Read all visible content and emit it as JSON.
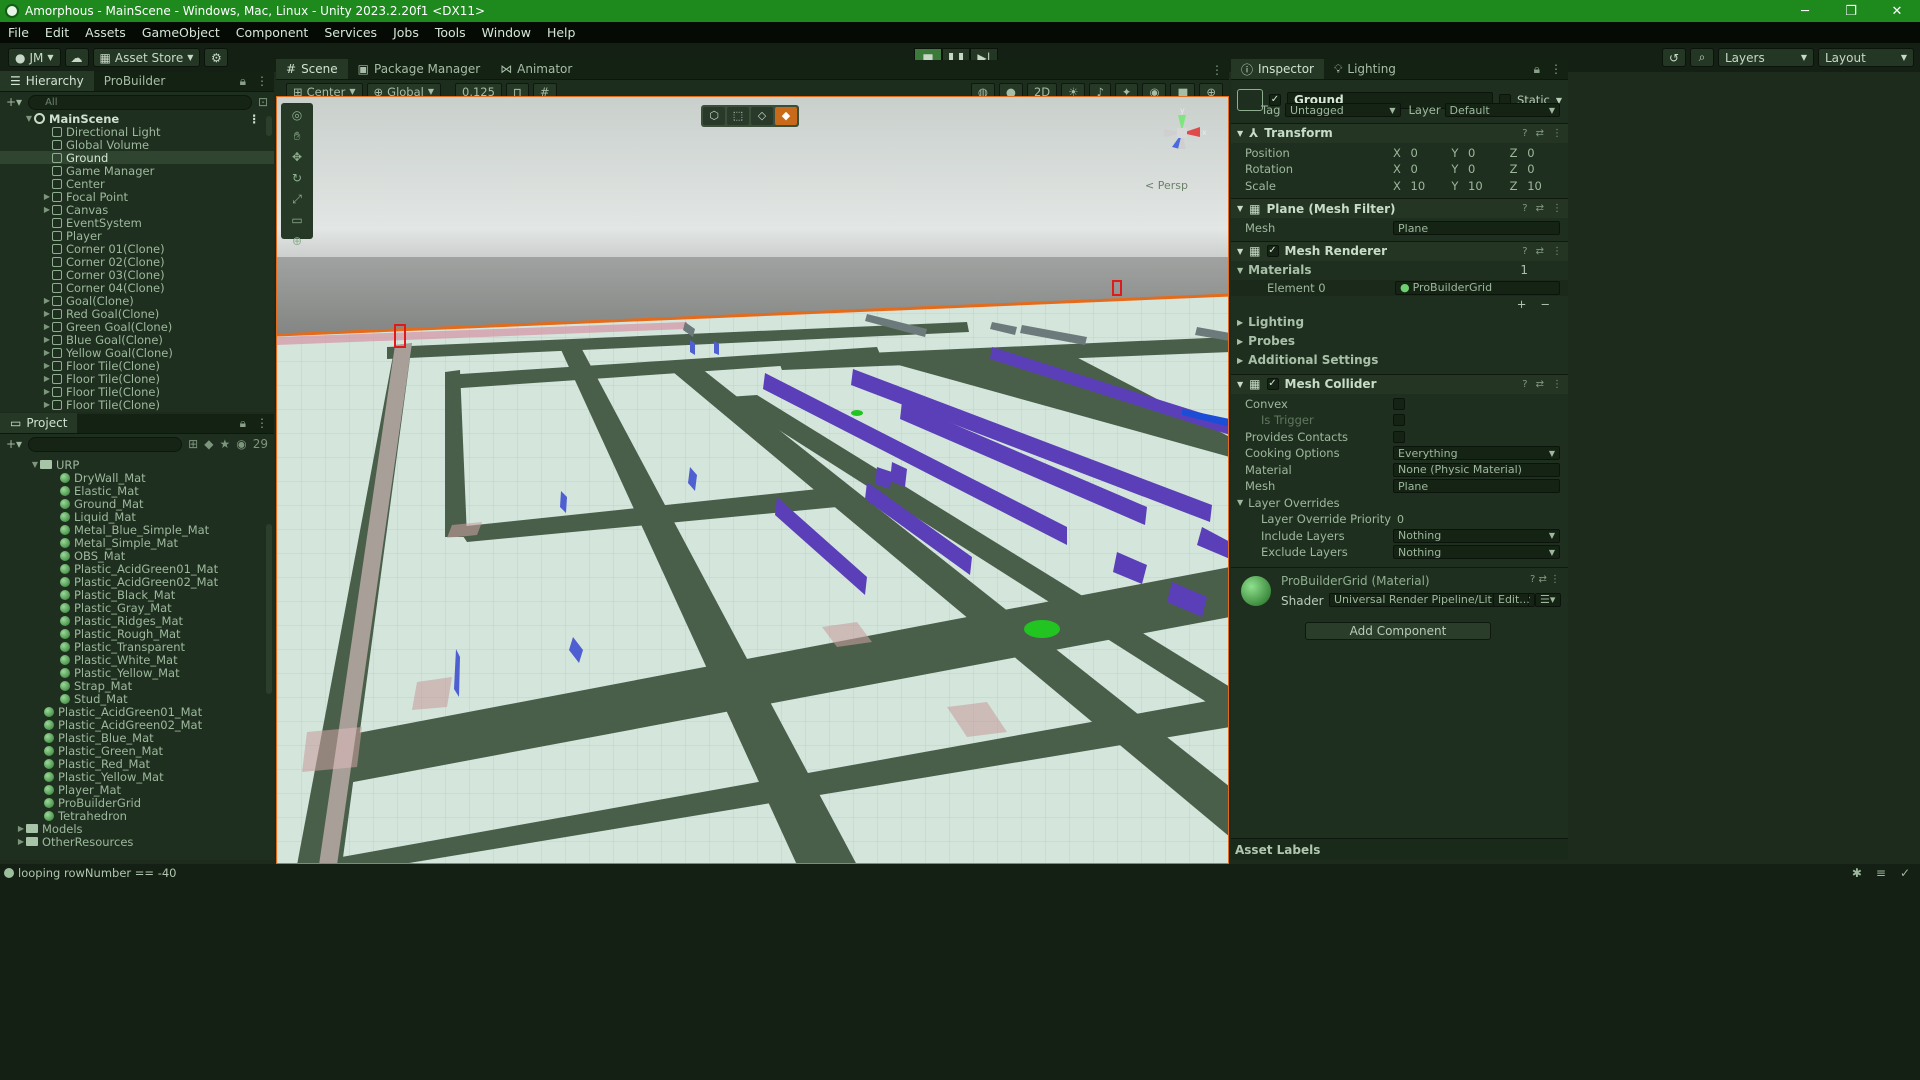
{
  "window": {
    "title": "Amorphous - MainScene - Windows, Mac, Linux - Unity 2023.2.20f1 <DX11>",
    "minimize": "─",
    "maximize": "❐",
    "close": "✕"
  },
  "menu": [
    "File",
    "Edit",
    "Assets",
    "GameObject",
    "Component",
    "Services",
    "Jobs",
    "Tools",
    "Window",
    "Help"
  ],
  "toolbar": {
    "account": "JM",
    "asset_store": "Asset Store",
    "layers": "Layers",
    "layout": "Layout"
  },
  "hierarchy": {
    "tabs": [
      "Hierarchy",
      "ProBuilder"
    ],
    "search_placeholder": "All",
    "scene": "MainScene",
    "items": [
      {
        "label": "Directional Light",
        "expandable": false
      },
      {
        "label": "Global Volume",
        "expandable": false
      },
      {
        "label": "Ground",
        "expandable": false,
        "selected": true
      },
      {
        "label": "Game Manager",
        "expandable": false
      },
      {
        "label": "Center",
        "expandable": false
      },
      {
        "label": "Focal Point",
        "expandable": true
      },
      {
        "label": "Canvas",
        "expandable": true
      },
      {
        "label": "EventSystem",
        "expandable": false
      },
      {
        "label": "Player",
        "expandable": false
      },
      {
        "label": "Corner 01(Clone)",
        "expandable": false
      },
      {
        "label": "Corner 02(Clone)",
        "expandable": false
      },
      {
        "label": "Corner 03(Clone)",
        "expandable": false
      },
      {
        "label": "Corner 04(Clone)",
        "expandable": false
      },
      {
        "label": "Goal(Clone)",
        "expandable": true
      },
      {
        "label": "Red Goal(Clone)",
        "expandable": true
      },
      {
        "label": "Green Goal(Clone)",
        "expandable": true
      },
      {
        "label": "Blue Goal(Clone)",
        "expandable": true
      },
      {
        "label": "Yellow Goal(Clone)",
        "expandable": true
      },
      {
        "label": "Floor Tile(Clone)",
        "expandable": true
      },
      {
        "label": "Floor Tile(Clone)",
        "expandable": true
      },
      {
        "label": "Floor Tile(Clone)",
        "expandable": true
      },
      {
        "label": "Floor Tile(Clone)",
        "expandable": true
      },
      {
        "label": "Floor Tile(Clone)",
        "expandable": true
      },
      {
        "label": "Floor Tile(Clone)",
        "expandable": true
      }
    ]
  },
  "project": {
    "tab": "Project",
    "count": "29",
    "urp_folder": "URP",
    "urp_items": [
      "DryWall_Mat",
      "Elastic_Mat",
      "Ground_Mat",
      "Liquid_Mat",
      "Metal_Blue_Simple_Mat",
      "Metal_Simple_Mat",
      "OBS_Mat",
      "Plastic_AcidGreen01_Mat",
      "Plastic_AcidGreen02_Mat",
      "Plastic_Black_Mat",
      "Plastic_Gray_Mat",
      "Plastic_Ridges_Mat",
      "Plastic_Rough_Mat",
      "Plastic_Transparent",
      "Plastic_White_Mat",
      "Plastic_Yellow_Mat",
      "Strap_Mat",
      "Stud_Mat"
    ],
    "root_items": [
      "Plastic_AcidGreen01_Mat",
      "Plastic_AcidGreen02_Mat",
      "Plastic_Blue_Mat",
      "Plastic_Green_Mat",
      "Plastic_Red_Mat",
      "Plastic_Yellow_Mat",
      "Player_Mat",
      "ProBuilderGrid",
      "Tetrahedron"
    ],
    "folders": [
      "Models",
      "OtherResources"
    ]
  },
  "scene": {
    "tabs": [
      "Scene",
      "Package Manager",
      "Animator"
    ],
    "pivot": "Center",
    "space": "Global",
    "snap": "0.125",
    "mode_2d": "2D",
    "persp": "< Persp",
    "axis_x": "x",
    "axis_y": "y"
  },
  "inspector": {
    "tabs": [
      "Inspector",
      "Lighting"
    ],
    "object_name": "Ground",
    "static": "Static",
    "tag_label": "Tag",
    "tag": "Untagged",
    "layer_label": "Layer",
    "layer": "Default",
    "transform": {
      "title": "Transform",
      "position": {
        "label": "Position",
        "x": "0",
        "y": "0",
        "z": "0"
      },
      "rotation": {
        "label": "Rotation",
        "x": "0",
        "y": "0",
        "z": "0"
      },
      "scale": {
        "label": "Scale",
        "x": "10",
        "y": "10",
        "z": "10"
      }
    },
    "mesh_filter": {
      "title": "Plane (Mesh Filter)",
      "mesh_label": "Mesh",
      "mesh": "Plane"
    },
    "mesh_renderer": {
      "title": "Mesh Renderer",
      "materials_label": "Materials",
      "materials_count": "1",
      "element_label": "Element 0",
      "element_value": "ProBuilderGrid",
      "sections": [
        "Lighting",
        "Probes",
        "Additional Settings"
      ]
    },
    "mesh_collider": {
      "title": "Mesh Collider",
      "convex": "Convex",
      "is_trigger": "Is Trigger",
      "provides_contacts": "Provides Contacts",
      "cooking_label": "Cooking Options",
      "cooking": "Everything",
      "material_label": "Material",
      "material": "None (Physic Material)",
      "mesh_label": "Mesh",
      "mesh": "Plane",
      "layer_overrides": "Layer Overrides",
      "priority_label": "Layer Override Priority",
      "priority": "0",
      "include_label": "Include Layers",
      "include": "Nothing",
      "exclude_label": "Exclude Layers",
      "exclude": "Nothing"
    },
    "material": {
      "title": "ProBuilderGrid (Material)",
      "shader_label": "Shader",
      "shader": "Universal Render Pipeline/Lit",
      "edit": "Edit..."
    },
    "add_component": "Add Component",
    "asset_labels": "Asset Labels"
  },
  "status": {
    "message": "looping rowNumber == -40"
  },
  "colors": {
    "accent": "#1e8a1e",
    "selection_outline": "#e46b1c",
    "wall": "#5a3fb8",
    "goal_green": "#22c422"
  }
}
